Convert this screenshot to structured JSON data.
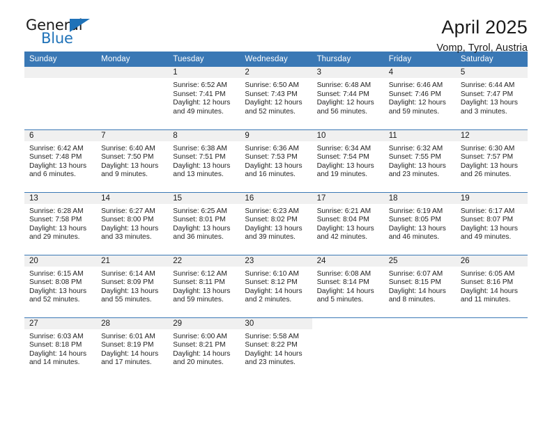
{
  "brand": {
    "name_top": "General",
    "name_bottom": "Blue",
    "flag_icon": "triangle-flag-icon",
    "color_top": "#1a1a1a",
    "color_bottom": "#1f72b8"
  },
  "header": {
    "title": "April 2025",
    "subtitle": "Vomp, Tyrol, Austria"
  },
  "theme": {
    "header_bg": "#3a78b5",
    "header_text": "#ffffff",
    "daynum_bg": "#f0f0f0",
    "row_separator": "#3a78b5",
    "body_text": "#222222"
  },
  "calendar": {
    "weekday_headers": [
      "Sunday",
      "Monday",
      "Tuesday",
      "Wednesday",
      "Thursday",
      "Friday",
      "Saturday"
    ],
    "weeks": [
      [
        {
          "day": "",
          "lines": []
        },
        {
          "day": "",
          "lines": []
        },
        {
          "day": "1",
          "lines": [
            "Sunrise: 6:52 AM",
            "Sunset: 7:41 PM",
            "Daylight: 12 hours",
            "and 49 minutes."
          ]
        },
        {
          "day": "2",
          "lines": [
            "Sunrise: 6:50 AM",
            "Sunset: 7:43 PM",
            "Daylight: 12 hours",
            "and 52 minutes."
          ]
        },
        {
          "day": "3",
          "lines": [
            "Sunrise: 6:48 AM",
            "Sunset: 7:44 PM",
            "Daylight: 12 hours",
            "and 56 minutes."
          ]
        },
        {
          "day": "4",
          "lines": [
            "Sunrise: 6:46 AM",
            "Sunset: 7:46 PM",
            "Daylight: 12 hours",
            "and 59 minutes."
          ]
        },
        {
          "day": "5",
          "lines": [
            "Sunrise: 6:44 AM",
            "Sunset: 7:47 PM",
            "Daylight: 13 hours",
            "and 3 minutes."
          ]
        }
      ],
      [
        {
          "day": "6",
          "lines": [
            "Sunrise: 6:42 AM",
            "Sunset: 7:48 PM",
            "Daylight: 13 hours",
            "and 6 minutes."
          ]
        },
        {
          "day": "7",
          "lines": [
            "Sunrise: 6:40 AM",
            "Sunset: 7:50 PM",
            "Daylight: 13 hours",
            "and 9 minutes."
          ]
        },
        {
          "day": "8",
          "lines": [
            "Sunrise: 6:38 AM",
            "Sunset: 7:51 PM",
            "Daylight: 13 hours",
            "and 13 minutes."
          ]
        },
        {
          "day": "9",
          "lines": [
            "Sunrise: 6:36 AM",
            "Sunset: 7:53 PM",
            "Daylight: 13 hours",
            "and 16 minutes."
          ]
        },
        {
          "day": "10",
          "lines": [
            "Sunrise: 6:34 AM",
            "Sunset: 7:54 PM",
            "Daylight: 13 hours",
            "and 19 minutes."
          ]
        },
        {
          "day": "11",
          "lines": [
            "Sunrise: 6:32 AM",
            "Sunset: 7:55 PM",
            "Daylight: 13 hours",
            "and 23 minutes."
          ]
        },
        {
          "day": "12",
          "lines": [
            "Sunrise: 6:30 AM",
            "Sunset: 7:57 PM",
            "Daylight: 13 hours",
            "and 26 minutes."
          ]
        }
      ],
      [
        {
          "day": "13",
          "lines": [
            "Sunrise: 6:28 AM",
            "Sunset: 7:58 PM",
            "Daylight: 13 hours",
            "and 29 minutes."
          ]
        },
        {
          "day": "14",
          "lines": [
            "Sunrise: 6:27 AM",
            "Sunset: 8:00 PM",
            "Daylight: 13 hours",
            "and 33 minutes."
          ]
        },
        {
          "day": "15",
          "lines": [
            "Sunrise: 6:25 AM",
            "Sunset: 8:01 PM",
            "Daylight: 13 hours",
            "and 36 minutes."
          ]
        },
        {
          "day": "16",
          "lines": [
            "Sunrise: 6:23 AM",
            "Sunset: 8:02 PM",
            "Daylight: 13 hours",
            "and 39 minutes."
          ]
        },
        {
          "day": "17",
          "lines": [
            "Sunrise: 6:21 AM",
            "Sunset: 8:04 PM",
            "Daylight: 13 hours",
            "and 42 minutes."
          ]
        },
        {
          "day": "18",
          "lines": [
            "Sunrise: 6:19 AM",
            "Sunset: 8:05 PM",
            "Daylight: 13 hours",
            "and 46 minutes."
          ]
        },
        {
          "day": "19",
          "lines": [
            "Sunrise: 6:17 AM",
            "Sunset: 8:07 PM",
            "Daylight: 13 hours",
            "and 49 minutes."
          ]
        }
      ],
      [
        {
          "day": "20",
          "lines": [
            "Sunrise: 6:15 AM",
            "Sunset: 8:08 PM",
            "Daylight: 13 hours",
            "and 52 minutes."
          ]
        },
        {
          "day": "21",
          "lines": [
            "Sunrise: 6:14 AM",
            "Sunset: 8:09 PM",
            "Daylight: 13 hours",
            "and 55 minutes."
          ]
        },
        {
          "day": "22",
          "lines": [
            "Sunrise: 6:12 AM",
            "Sunset: 8:11 PM",
            "Daylight: 13 hours",
            "and 59 minutes."
          ]
        },
        {
          "day": "23",
          "lines": [
            "Sunrise: 6:10 AM",
            "Sunset: 8:12 PM",
            "Daylight: 14 hours",
            "and 2 minutes."
          ]
        },
        {
          "day": "24",
          "lines": [
            "Sunrise: 6:08 AM",
            "Sunset: 8:14 PM",
            "Daylight: 14 hours",
            "and 5 minutes."
          ]
        },
        {
          "day": "25",
          "lines": [
            "Sunrise: 6:07 AM",
            "Sunset: 8:15 PM",
            "Daylight: 14 hours",
            "and 8 minutes."
          ]
        },
        {
          "day": "26",
          "lines": [
            "Sunrise: 6:05 AM",
            "Sunset: 8:16 PM",
            "Daylight: 14 hours",
            "and 11 minutes."
          ]
        }
      ],
      [
        {
          "day": "27",
          "lines": [
            "Sunrise: 6:03 AM",
            "Sunset: 8:18 PM",
            "Daylight: 14 hours",
            "and 14 minutes."
          ]
        },
        {
          "day": "28",
          "lines": [
            "Sunrise: 6:01 AM",
            "Sunset: 8:19 PM",
            "Daylight: 14 hours",
            "and 17 minutes."
          ]
        },
        {
          "day": "29",
          "lines": [
            "Sunrise: 6:00 AM",
            "Sunset: 8:21 PM",
            "Daylight: 14 hours",
            "and 20 minutes."
          ]
        },
        {
          "day": "30",
          "lines": [
            "Sunrise: 5:58 AM",
            "Sunset: 8:22 PM",
            "Daylight: 14 hours",
            "and 23 minutes."
          ]
        },
        {
          "day": "",
          "lines": []
        },
        {
          "day": "",
          "lines": []
        },
        {
          "day": "",
          "lines": []
        }
      ]
    ]
  }
}
